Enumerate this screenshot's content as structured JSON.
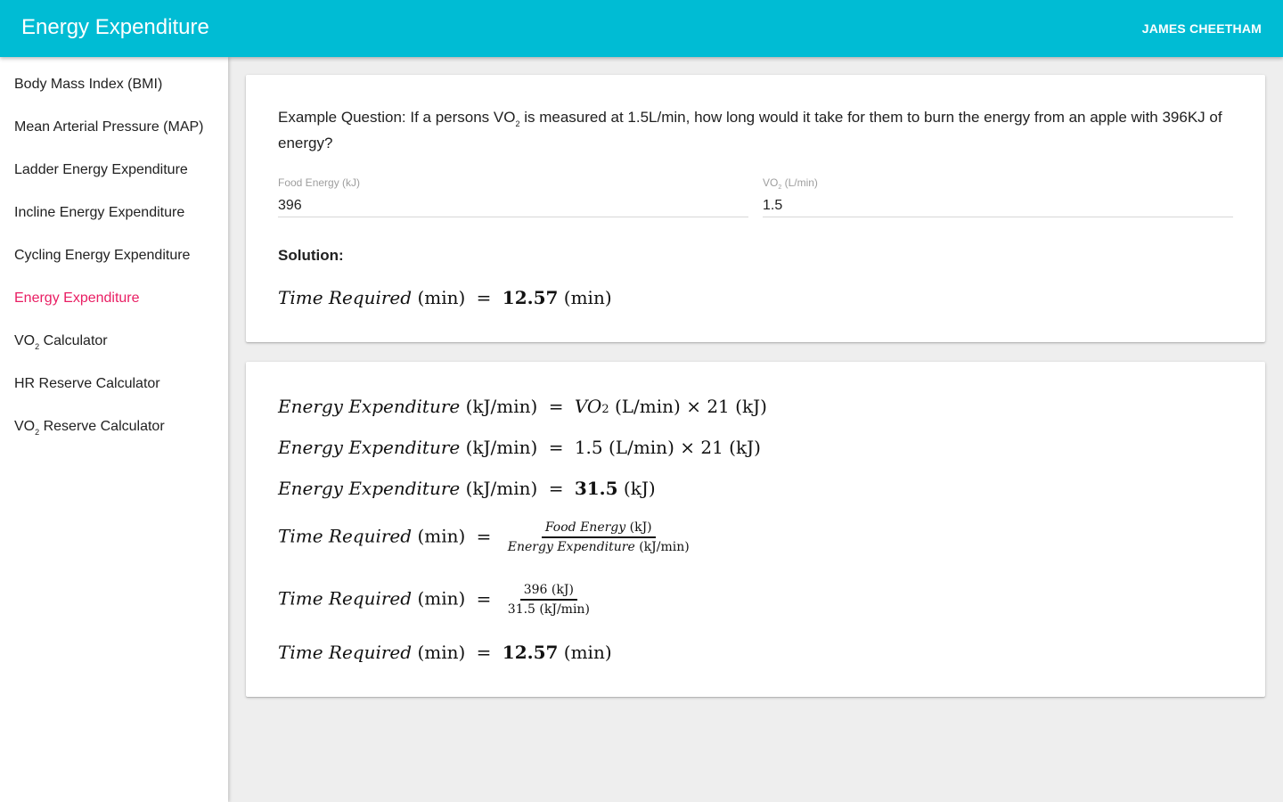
{
  "app": {
    "title": "Energy Expenditure",
    "user": "JAMES CHEETHAM"
  },
  "nav": {
    "items": [
      {
        "label": "Body Mass Index (BMI)"
      },
      {
        "label": "Mean Arterial Pressure (MAP)"
      },
      {
        "label": "Ladder Energy Expenditure"
      },
      {
        "label": "Incline Energy Expenditure"
      },
      {
        "label": "Cycling Energy Expenditure"
      },
      {
        "label": "Energy Expenditure",
        "active": true
      },
      {
        "label_pre": "VO",
        "label_sub": "2",
        "label_post": " Calculator"
      },
      {
        "label": "HR Reserve Calculator"
      },
      {
        "label_pre": "VO",
        "label_sub": "2",
        "label_post": " Reserve Calculator"
      }
    ]
  },
  "question": {
    "pre": "Example Question: If a persons VO",
    "sub": "2",
    "post": " is measured at 1.5L/min, how long would it take for them to burn the energy from an apple with 396KJ of energy?"
  },
  "fields": {
    "food_energy": {
      "label": "Food Energy (kJ)",
      "value": "396"
    },
    "vo2": {
      "label_pre": "VO",
      "label_sub": "2",
      "label_post": " (L/min)",
      "value": "1.5"
    }
  },
  "solution": {
    "heading": "Solution:",
    "result": "12.57"
  },
  "math": {
    "time_required": "Time Required",
    "energy_expenditure": "Energy Expenditure",
    "food_energy": "Food Energy",
    "unit_min": "(min)",
    "unit_kj_min": "(kJ/min)",
    "unit_kj": "(kJ)",
    "unit_l_min": "(L/min)",
    "vo2": "VO",
    "vo2_sub": "2",
    "times": "×",
    "equals": "=",
    "factor": "21",
    "vo2_value": "1.5",
    "ee_value": "31.5",
    "food_value": "396",
    "result": "12.57"
  }
}
